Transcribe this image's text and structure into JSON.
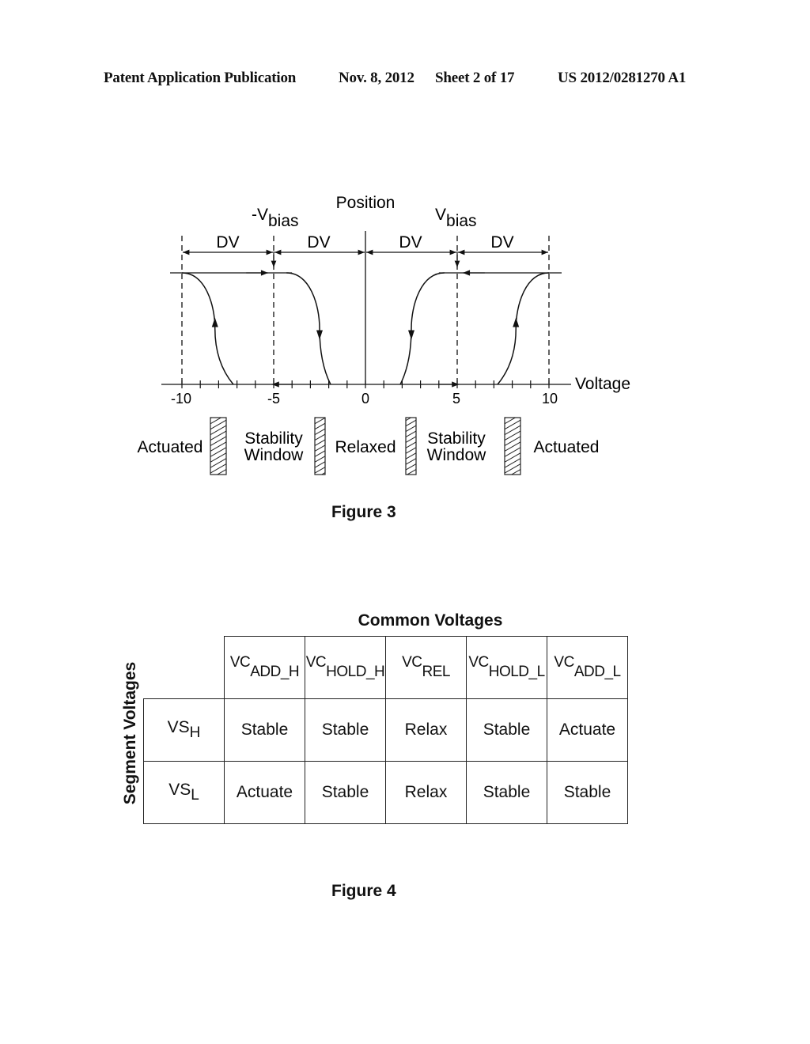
{
  "header": {
    "left": "Patent Application Publication",
    "date": "Nov. 8, 2012",
    "sheet": "Sheet 2 of 17",
    "number": "US 2012/0281270 A1"
  },
  "figure3": {
    "caption": "Figure 3",
    "y_axis_label": "Position",
    "x_axis_label": "Voltage",
    "neg_bias_label": "-V",
    "neg_bias_sub": "bias",
    "pos_bias_label": "V",
    "pos_bias_sub": "bias",
    "dv_labels": [
      "DV",
      "DV",
      "DV",
      "DV"
    ],
    "tick_labels": [
      "-10",
      "-5",
      "0",
      "5",
      "10"
    ],
    "regions": [
      {
        "label_lines": [
          "Actuated"
        ]
      },
      {
        "label_lines": [
          "Stability",
          "Window"
        ]
      },
      {
        "label_lines": [
          "Relaxed"
        ]
      },
      {
        "label_lines": [
          "Stability",
          "Window"
        ]
      },
      {
        "label_lines": [
          "Actuated"
        ]
      }
    ]
  },
  "chart_data": {
    "type": "line",
    "title": "",
    "xlabel": "Voltage",
    "ylabel": "Position",
    "xlim": [
      -11,
      11
    ],
    "ylim": [
      0,
      1
    ],
    "x_ticks": [
      -10,
      -9,
      -8,
      -7,
      -6,
      -5,
      -4,
      -3,
      -2,
      -1,
      0,
      1,
      2,
      3,
      4,
      5,
      6,
      7,
      8,
      9,
      10
    ],
    "x_tick_labels": [
      "-10",
      "-5",
      "0",
      "5",
      "10"
    ],
    "dashed_reference_lines": [
      -10,
      -5,
      5,
      10
    ],
    "annotations": [
      "-Vbias at -5",
      "Vbias at 5",
      "DV spans: -10 to -5, -5 to 0, 0 to 5, 5 to 10"
    ],
    "series": [
      {
        "name": "negative actuation (rising)",
        "x": [
          -7.2,
          -7.8,
          -8.2,
          -8.5,
          -9.0,
          -9.5,
          -10
        ],
        "y": [
          0,
          0.2,
          0.5,
          0.75,
          0.93,
          0.99,
          1
        ],
        "direction": "up"
      },
      {
        "name": "negative release (falling)",
        "x": [
          -4,
          -2.8,
          -2.5,
          -2.3,
          -2.0
        ],
        "y": [
          1,
          0.95,
          0.7,
          0.4,
          0
        ],
        "direction": "down"
      },
      {
        "name": "positive release (falling)",
        "x": [
          4,
          2.8,
          2.5,
          2.3,
          2.0
        ],
        "y": [
          1,
          0.95,
          0.7,
          0.4,
          0
        ],
        "direction": "down"
      },
      {
        "name": "positive actuation (rising)",
        "x": [
          7.2,
          7.8,
          8.2,
          8.5,
          9.0,
          9.5,
          10
        ],
        "y": [
          0,
          0.2,
          0.5,
          0.75,
          0.93,
          0.99,
          1
        ],
        "direction": "up"
      }
    ]
  },
  "figure4": {
    "caption": "Figure 4",
    "title": "Common Voltages",
    "row_axis_label": "Segment Voltages",
    "columns": [
      {
        "main": "VC",
        "sub": "ADD_H"
      },
      {
        "main": "VC",
        "sub": "HOLD_H"
      },
      {
        "main": "VC",
        "sub": "REL"
      },
      {
        "main": "VC",
        "sub": "HOLD_L"
      },
      {
        "main": "VC",
        "sub": "ADD_L"
      }
    ],
    "rows": [
      {
        "main": "VS",
        "sub": "H",
        "cells": [
          "Stable",
          "Stable",
          "Relax",
          "Stable",
          "Actuate"
        ]
      },
      {
        "main": "VS",
        "sub": "L",
        "cells": [
          "Actuate",
          "Stable",
          "Relax",
          "Stable",
          "Stable"
        ]
      }
    ]
  }
}
